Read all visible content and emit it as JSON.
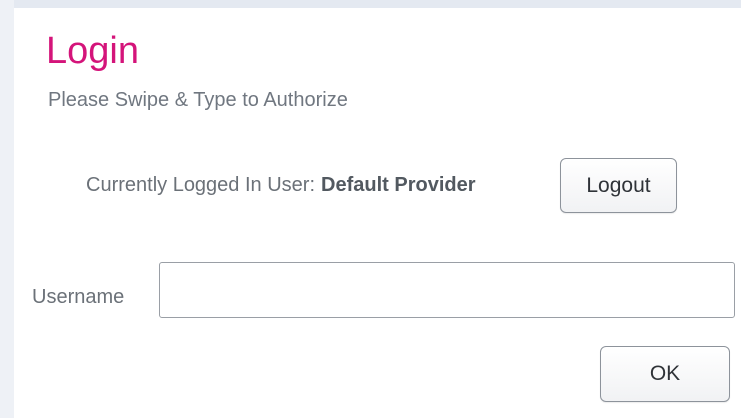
{
  "dialog": {
    "title": "Login",
    "subtitle": "Please Swipe & Type to Authorize"
  },
  "session": {
    "current_user_label": "Currently Logged In User:",
    "current_user_name": "Default Provider",
    "logout_label": "Logout"
  },
  "form": {
    "username_label": "Username",
    "username_value": "",
    "ok_label": "OK"
  },
  "colors": {
    "title": "#d4147a",
    "text": "#6b7178"
  }
}
